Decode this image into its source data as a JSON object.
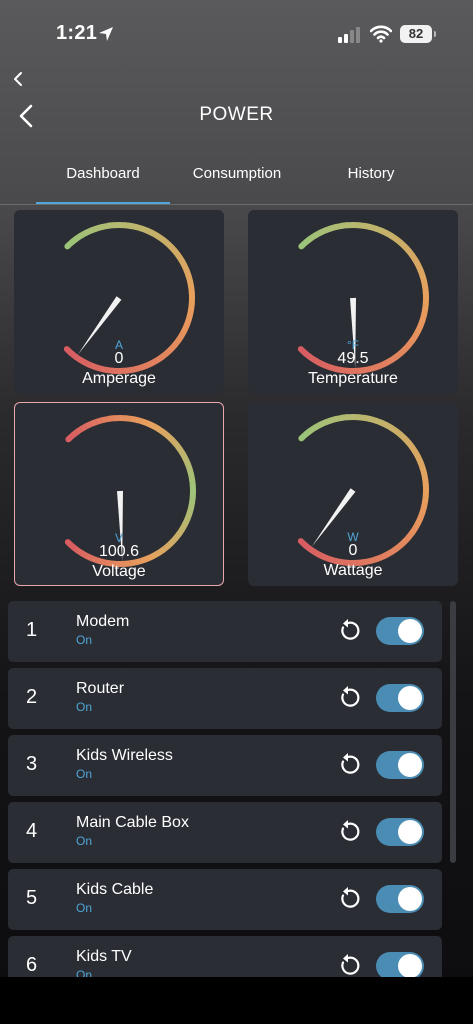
{
  "status_bar": {
    "time": "1:21",
    "battery": "82",
    "icons": [
      "location-arrow-icon",
      "cellular-signal-icon",
      "wifi-icon",
      "battery-icon"
    ]
  },
  "header": {
    "title": "POWER",
    "back_icon": "chevron-left-icon"
  },
  "tabs": [
    {
      "label": "Dashboard",
      "active": true
    },
    {
      "label": "Consumption",
      "active": false
    },
    {
      "label": "History",
      "active": false
    }
  ],
  "colors": {
    "accent": "#4fa6d9",
    "card": "#2a2d33",
    "gauge_green": "#9bc47a",
    "gauge_orange": "#e8a05c",
    "gauge_red": "#d85c62",
    "toggle_on": "#4a8cb3",
    "selected_border": "#e8a6ad"
  },
  "gauges": [
    {
      "label": "Amperage",
      "unit": "A",
      "value": "0",
      "needle_fraction": 0.3,
      "gradient": "green-orange-red"
    },
    {
      "label": "Temperature",
      "unit": "°F",
      "value": "49.5",
      "needle_fraction": 0.16,
      "gradient": "green-orange-red"
    },
    {
      "label": "Voltage",
      "unit": "V",
      "value": "100.6",
      "needle_fraction": 0.16,
      "gradient": "red-orange-green-orange-red",
      "selected": true
    },
    {
      "label": "Wattage",
      "unit": "W",
      "value": "0",
      "needle_fraction": 0.3,
      "gradient": "green-orange-red"
    }
  ],
  "outlets": [
    {
      "number": "1",
      "name": "Modem",
      "status": "On",
      "enabled": true
    },
    {
      "number": "2",
      "name": "Router",
      "status": "On",
      "enabled": true
    },
    {
      "number": "3",
      "name": "Kids Wireless",
      "status": "On",
      "enabled": true
    },
    {
      "number": "4",
      "name": "Main Cable Box",
      "status": "On",
      "enabled": true
    },
    {
      "number": "5",
      "name": "Kids Cable",
      "status": "On",
      "enabled": true
    },
    {
      "number": "6",
      "name": "Kids TV",
      "status": "On",
      "enabled": true
    }
  ]
}
